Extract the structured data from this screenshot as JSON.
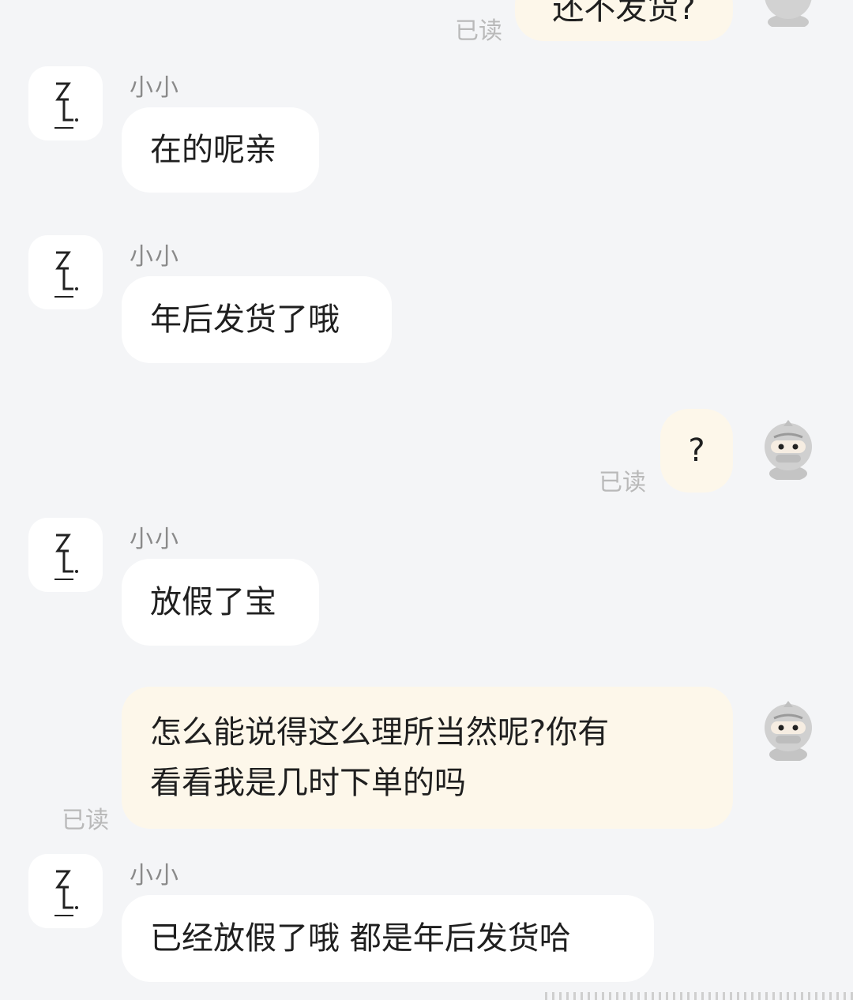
{
  "chat": {
    "read_label": "已读",
    "shop_sender": "小小",
    "messages": [
      {
        "side": "out",
        "text": "还不发货?",
        "read": true
      },
      {
        "side": "in",
        "sender": "小小",
        "text": "在的呢亲"
      },
      {
        "side": "in",
        "sender": "小小",
        "text": "年后发货了哦"
      },
      {
        "side": "out",
        "text": "?",
        "read": true
      },
      {
        "side": "in",
        "sender": "小小",
        "text": "放假了宝"
      },
      {
        "side": "out",
        "text_line1": "怎么能说得这么理所当然呢?你有",
        "text_line2": "看看我是几时下单的吗",
        "read": true
      },
      {
        "side": "in",
        "sender": "小小",
        "text": "已经放假了哦 都是年后发货哈"
      }
    ]
  },
  "colors": {
    "background": "#f4f5f7",
    "incoming_bubble": "#ffffff",
    "outgoing_bubble": "#fdf7ea",
    "read_text": "#b9b9b9",
    "sender_text": "#8a8a8a"
  },
  "icons": {
    "shop_avatar": "zl-logo-icon",
    "user_avatar": "ninja-avatar-icon"
  }
}
